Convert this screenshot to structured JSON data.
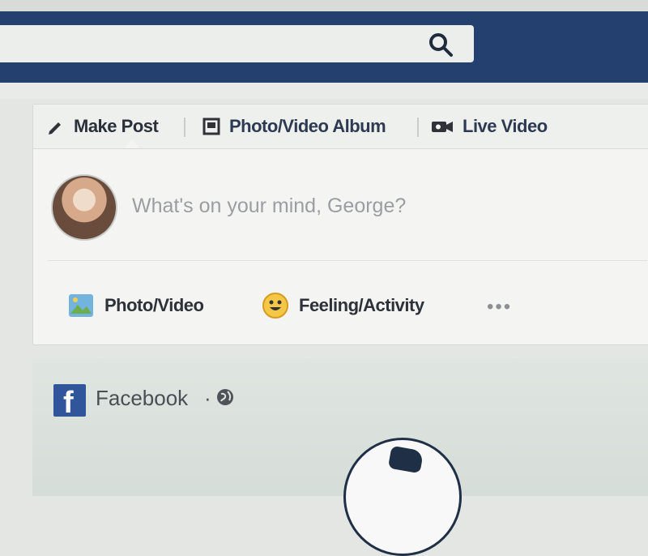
{
  "header": {
    "search_icon": "search-icon"
  },
  "composer": {
    "tabs": [
      {
        "label": "Make Post",
        "icon": "pencil-icon"
      },
      {
        "label": "Photo/Video Album",
        "icon": "album-icon"
      },
      {
        "label": "Live Video",
        "icon": "video-camera-icon"
      }
    ],
    "input": {
      "placeholder": "What's on your mind, George?",
      "value": ""
    },
    "actions": [
      {
        "label": "Photo/Video",
        "icon": "photo-icon"
      },
      {
        "label": "Feeling/Activity",
        "icon": "smile-icon"
      },
      {
        "label": "•••",
        "icon": "more-icon"
      }
    ]
  },
  "feed": {
    "post": {
      "source": "Facebook",
      "separator": "·",
      "privacy_icon": "globe-icon"
    }
  },
  "colors": {
    "header_blue": "#23406f",
    "facebook_blue": "#30559b",
    "background": "#e4e6e3"
  }
}
